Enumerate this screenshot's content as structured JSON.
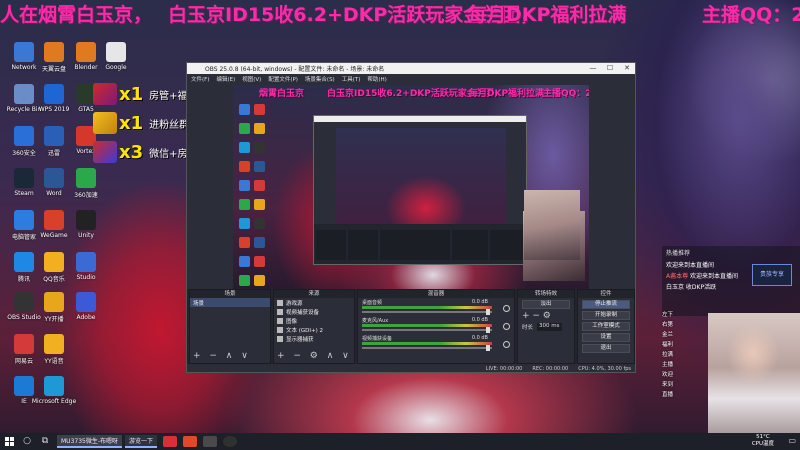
{
  "ticker": {
    "seg1": "人在烟霄白玉京，",
    "seg2": "白玉京ID15收6.2+DKP活跃玩家金兰团，",
    "seg3": "每月DKP福利拉满",
    "seg4": "主播QQ：2"
  },
  "badges": [
    {
      "multiplier": "x1",
      "label": "房管+福利群"
    },
    {
      "multiplier": "x1",
      "label": "进粉丝群"
    },
    {
      "multiplier": "x3",
      "label": "微信+房管"
    }
  ],
  "desktop_icons": [
    {
      "label": "Network",
      "icon": "network-icon",
      "color": "#3a78d4"
    },
    {
      "label": "Recycle Bin",
      "icon": "recycle-bin-icon",
      "color": "#6a8cc8"
    },
    {
      "label": "360安全",
      "icon": "shield-icon",
      "color": "#2a6fd8"
    },
    {
      "label": "Steam",
      "icon": "steam-icon",
      "color": "#1b2838"
    },
    {
      "label": "电脑管家",
      "icon": "tencent-guard-icon",
      "color": "#2d7de0"
    },
    {
      "label": "腾讯",
      "icon": "tencent-icon",
      "color": "#1d88e6"
    },
    {
      "label": "OBS Studio",
      "icon": "obs-icon",
      "color": "#333333"
    },
    {
      "label": "网易云",
      "icon": "netease-icon",
      "color": "#d43a3a"
    },
    {
      "label": "IE",
      "icon": "ie-icon",
      "color": "#1d7ad4"
    },
    {
      "label": "天翼云盘",
      "icon": "cloud-icon",
      "color": "#e07a20"
    },
    {
      "label": "WPS 2019",
      "icon": "wps-icon",
      "color": "#1d66d4"
    },
    {
      "label": "迅雷",
      "icon": "thunder-icon",
      "color": "#2a5fb8"
    },
    {
      "label": "Word",
      "icon": "word-icon",
      "color": "#2b5797"
    },
    {
      "label": "WeGame",
      "icon": "wegame-icon",
      "color": "#d8402a"
    },
    {
      "label": "QQ音乐",
      "icon": "music-icon",
      "color": "#f2b01e"
    },
    {
      "label": "YY开播",
      "icon": "yy-icon",
      "color": "#e8a61b"
    },
    {
      "label": "YY语音",
      "icon": "yy-voice-icon",
      "color": "#f0b020"
    },
    {
      "label": "Microsoft Edge",
      "icon": "edge-icon",
      "color": "#1d9ad6"
    },
    {
      "label": "Blender",
      "icon": "blender-icon",
      "color": "#e07a20"
    },
    {
      "label": "GTA5",
      "icon": "gta-icon",
      "color": "#2a3a2a"
    },
    {
      "label": "Vortex",
      "icon": "vortex-icon",
      "color": "#d4382a"
    },
    {
      "label": "360加速",
      "icon": "accelerator-icon",
      "color": "#2aa84a"
    },
    {
      "label": "Unity",
      "icon": "unity-icon",
      "color": "#222222"
    },
    {
      "label": "Studio",
      "icon": "studio-icon",
      "color": "#3a6ad4"
    },
    {
      "label": "Adobe",
      "icon": "adobe-icon",
      "color": "#3a5ad8"
    },
    {
      "label": "Google",
      "icon": "google-icon",
      "color": "#e6e6e6"
    }
  ],
  "obs": {
    "title": "OBS 25.0.8 (64-bit, windows) - 配置文件: 未命名 - 场景: 未命名",
    "menu": [
      "文件(F)",
      "编辑(E)",
      "视图(V)",
      "配置文件(P)",
      "场景集合(S)",
      "工具(T)",
      "帮助(H)"
    ],
    "mini_ticker": {
      "seg1": "烟霄白玉京",
      "seg2": "白玉京ID15收6.2+DKP活跃玩家金兰团，",
      "seg3": "每月DKP福利拉满",
      "seg4": "主播QQ：2"
    },
    "docks": {
      "scenes_title": "场景",
      "scene_items": [
        "场景"
      ],
      "sources_title": "来源",
      "source_items": [
        "游戏源",
        "视频捕获设备",
        "图像",
        "文本 (GDI+) 2",
        "显示器捕获"
      ],
      "mixer_title": "混音器",
      "mixer_rows": [
        {
          "label": "桌面音频",
          "db": "0.0 dB"
        },
        {
          "label": "麦克风/Aux",
          "db": "0.0 dB"
        },
        {
          "label": "视频捕获设备",
          "db": "0.0 dB"
        }
      ],
      "transitions_title": "转场特效",
      "transition_value": "淡出",
      "duration_label": "时长",
      "duration_value": "300 ms",
      "controls_title": "控件",
      "controls": [
        "停止推流",
        "开始录制",
        "工作室模式",
        "设置",
        "退出"
      ]
    },
    "status": {
      "live": "LIVE: 00:00:00",
      "rec": "REC: 00:00:00",
      "cpu": "CPU: 4.0%, 30.00 fps"
    }
  },
  "chat": {
    "header": "热播推荐",
    "lines": [
      {
        "user": "",
        "text": "欢迎来到本直播间"
      },
      {
        "user": "A酱本尊",
        "text": "欢迎来到本直播间"
      },
      {
        "user": "",
        "text": "白玉京 收DKP活跃"
      }
    ]
  },
  "vip_label": "贵族专享",
  "side_list": [
    "左下",
    "右第",
    "金兰",
    "福利",
    "拉满",
    "主播",
    "欢迎",
    "来到",
    "直播"
  ],
  "taskbar": {
    "search": "MU3735微生-布嗯呀",
    "app2": "游览一下",
    "tray_temp": "51°C",
    "tray_label": "CPU温度"
  }
}
